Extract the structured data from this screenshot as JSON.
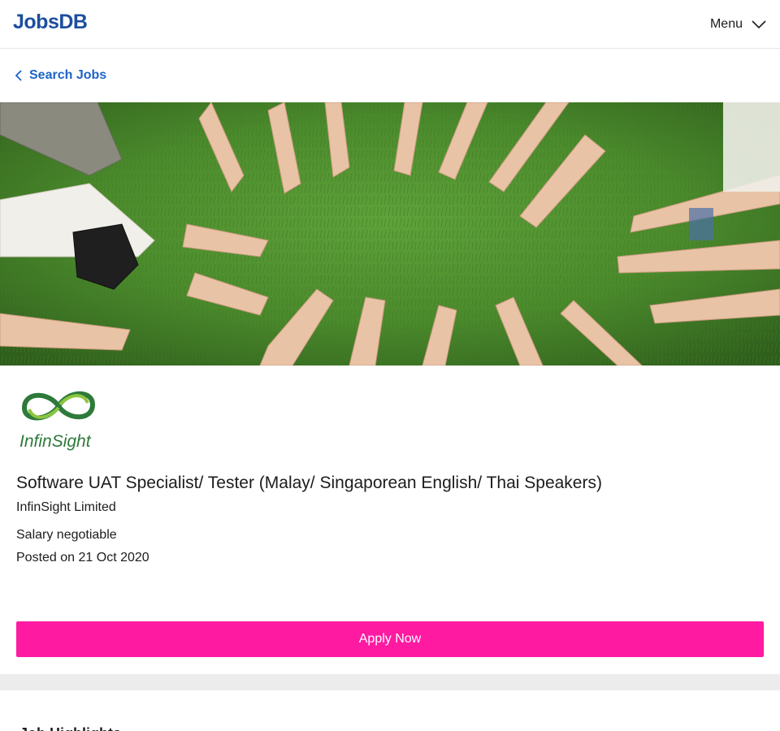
{
  "header": {
    "logo_text": "JobsDB",
    "menu_label": "Menu",
    "brand_color": "#1d4e9e"
  },
  "nav": {
    "back_label": "Search Jobs",
    "link_color": "#1d64c8"
  },
  "company": {
    "logo_wordmark": "InfinSight",
    "name": "InfinSight Limited"
  },
  "job": {
    "title": "Software UAT Specialist/ Tester (Malay/ Singaporean English/ Thai Speakers)",
    "salary": "Salary negotiable",
    "posted": "Posted on 21 Oct 2020"
  },
  "actions": {
    "apply_label": "Apply Now",
    "apply_color": "#ff1aa2"
  },
  "sections": {
    "highlights_heading": "Job Highlights"
  },
  "icons": {
    "menu": "chevron-down-icon",
    "back": "chevron-left-icon"
  }
}
